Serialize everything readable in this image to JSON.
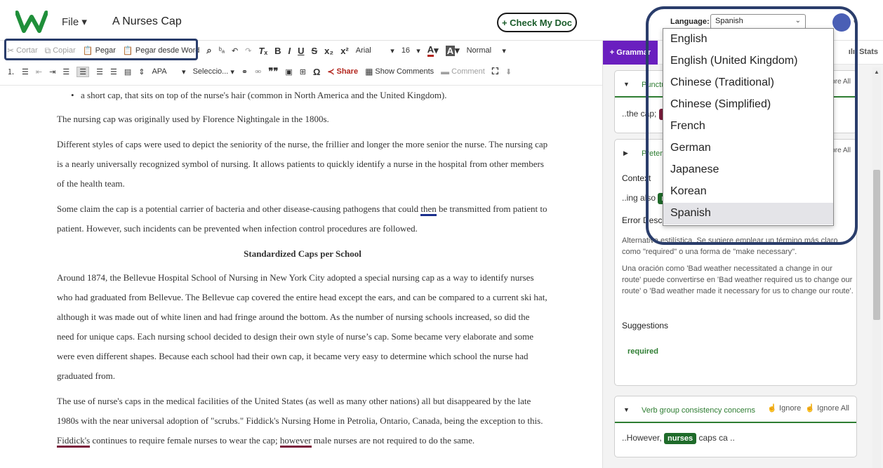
{
  "header": {
    "file_menu": "File",
    "doc_title": "A Nurses Cap",
    "check_button": "+ Check My Doc",
    "language_label": "Language:",
    "language_value": "Spanish"
  },
  "toolbar": {
    "cut": "Cortar",
    "copy": "Copiar",
    "paste": "Pegar",
    "paste_word": "Pegar desde Word",
    "font": "Arial",
    "font_size": "16",
    "style": "Normal",
    "citation": "APA",
    "select": "Seleccio...",
    "share": "Share",
    "show_comments": "Show Comments",
    "comment": "Comment"
  },
  "document": {
    "bullet": "a short cap, that sits on top of the nurse's hair (common in North America and the United Kingdom).",
    "p1": "The nursing cap was originally used by Florence Nightingale in the 1800s.",
    "p2": "Different styles of caps were used to depict the seniority of the nurse, the frillier and longer the more senior the nurse. The nursing cap is a nearly universally recognized symbol of nursing. It allows patients to quickly identify a nurse in the hospital from other members of the health team.",
    "p3_a": "Some claim the cap is a potential carrier of bacteria and other disease-causing pathogens that could ",
    "p3_u": "then",
    "p3_b": " be transmitted from patient to patient. However, such incidents can be prevented when infection control procedures are followed.",
    "heading": "Standardized Caps per School",
    "p4": "Around 1874, the Bellevue Hospital School of Nursing in New York City adopted a special nursing cap as a way to identify nurses who had graduated from Bellevue. The Bellevue cap covered the entire head except the ears, and can be compared to a current ski hat, although it was made out of white linen and had fringe around the bottom. As the number of nursing schools increased, so did the need for unique caps. Each nursing school decided to design their own style of nurse’s cap. Some became very elaborate and some were even different shapes. Because each school had their own cap, it became very easy to determine which school the nurse had graduated from.",
    "p5_a": "The use of nurse's caps in the medical facilities of the United States (as well as many other nations) all but disappeared by the late 1980s with the near universal adoption of \"scrubs.\" Fiddick's Nursing Home in Petrolia, Ontario, Canada, being the exception to this. ",
    "p5_u1": "Fiddick's",
    "p5_b": " continues to require female nurses to wear the cap; ",
    "p5_u2": "however",
    "p5_c": " male nurses are not required to do the same."
  },
  "panel": {
    "grammar_tab": "+ Grammar",
    "stats_tab": "Stats",
    "card1": {
      "title": "Punctu",
      "ignore_all": "Ignore All",
      "snippet_pre": "..the cap;",
      "chip": "ho"
    },
    "card2": {
      "title": "Pretent",
      "ignore_all": "Ignore All",
      "context_label": "Context",
      "snippet_pre": "..ing also",
      "chip": "n",
      "error_label": "Error Descr",
      "desc1": "Alternativa estilística. Se sugiere emplear un término más claro como \"required\" o una forma de \"make necessary\".",
      "desc2": "Una oración como 'Bad weather necessitated a change in our route' puede convertirse en 'Bad weather required us to change our route' o 'Bad weather made it necessary for us to change our route'.",
      "suggestions_label": "Suggestions",
      "suggestion": "required"
    },
    "card3": {
      "title": "Verb group consistency concerns",
      "ignore": "Ignore",
      "ignore_all": "Ignore All",
      "snippet_pre": "..However,",
      "chip": "nurses",
      "snippet_post": "caps ca .."
    }
  },
  "language_dropdown": {
    "options": [
      "English",
      "English (United Kingdom)",
      "Chinese (Traditional)",
      "Chinese (Simplified)",
      "French",
      "German",
      "Japanese",
      "Korean",
      "Spanish"
    ],
    "selected": "Spanish"
  },
  "colors": {
    "logo": "#1f8f3a",
    "grammar_tab": "#6a1fbf",
    "highlight_box": "#2a3d6b",
    "chip_maroon": "#7a1c3c",
    "chip_green": "#1f6b2a"
  }
}
